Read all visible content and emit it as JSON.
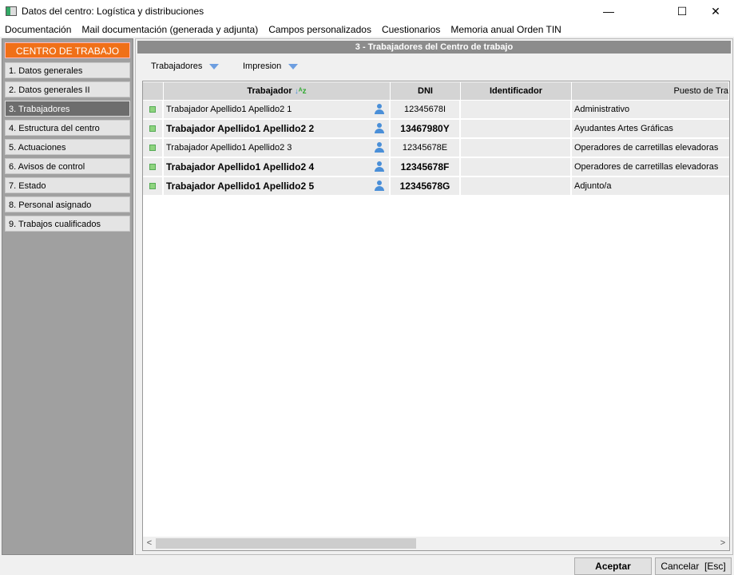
{
  "window": {
    "title": "Datos del centro: Logística y distribuciones",
    "minimize": "—",
    "maximize": "☐",
    "close": "✕"
  },
  "menu": [
    "Documentación",
    "Mail documentación (generada y adjunta)",
    "Campos personalizados",
    "Cuestionarios",
    "Memoria anual Orden TIN"
  ],
  "sidebar": {
    "header": "CENTRO DE TRABAJO",
    "items": [
      "1. Datos generales",
      "2. Datos generales II",
      "3. Trabajadores",
      "4. Estructura del centro",
      "5. Actuaciones",
      "6. Avisos de control",
      "7. Estado",
      "8. Personal asignado",
      "9. Trabajos cualificados"
    ],
    "active": 2
  },
  "main": {
    "title": "3 - Trabajadores del Centro de trabajo",
    "toolbar": [
      "Trabajadores",
      "Impresion"
    ]
  },
  "grid": {
    "columns": [
      "Trabajador",
      "DNI",
      "Identificador",
      "Puesto de Tra"
    ],
    "rows": [
      {
        "name": "Trabajador Apellido1 Apellido2 1",
        "dni": "12345678I",
        "id": "",
        "puesto": "Administrativo",
        "bold": false
      },
      {
        "name": "Trabajador Apellido1 Apellido2 2",
        "dni": "13467980Y",
        "id": "",
        "puesto": "Ayudantes Artes Gráficas",
        "bold": true
      },
      {
        "name": "Trabajador Apellido1 Apellido2 3",
        "dni": "12345678E",
        "id": "",
        "puesto": "Operadores de carretillas elevadoras",
        "bold": false
      },
      {
        "name": "Trabajador Apellido1 Apellido2 4",
        "dni": "12345678F",
        "id": "",
        "puesto": "Operadores de carretillas elevadoras",
        "bold": true
      },
      {
        "name": "Trabajador Apellido1 Apellido2 5",
        "dni": "12345678G",
        "id": "",
        "puesto": "Adjunto/a",
        "bold": true
      }
    ]
  },
  "buttons": {
    "accept": "Aceptar",
    "cancel": "Cancelar  [Esc]"
  }
}
